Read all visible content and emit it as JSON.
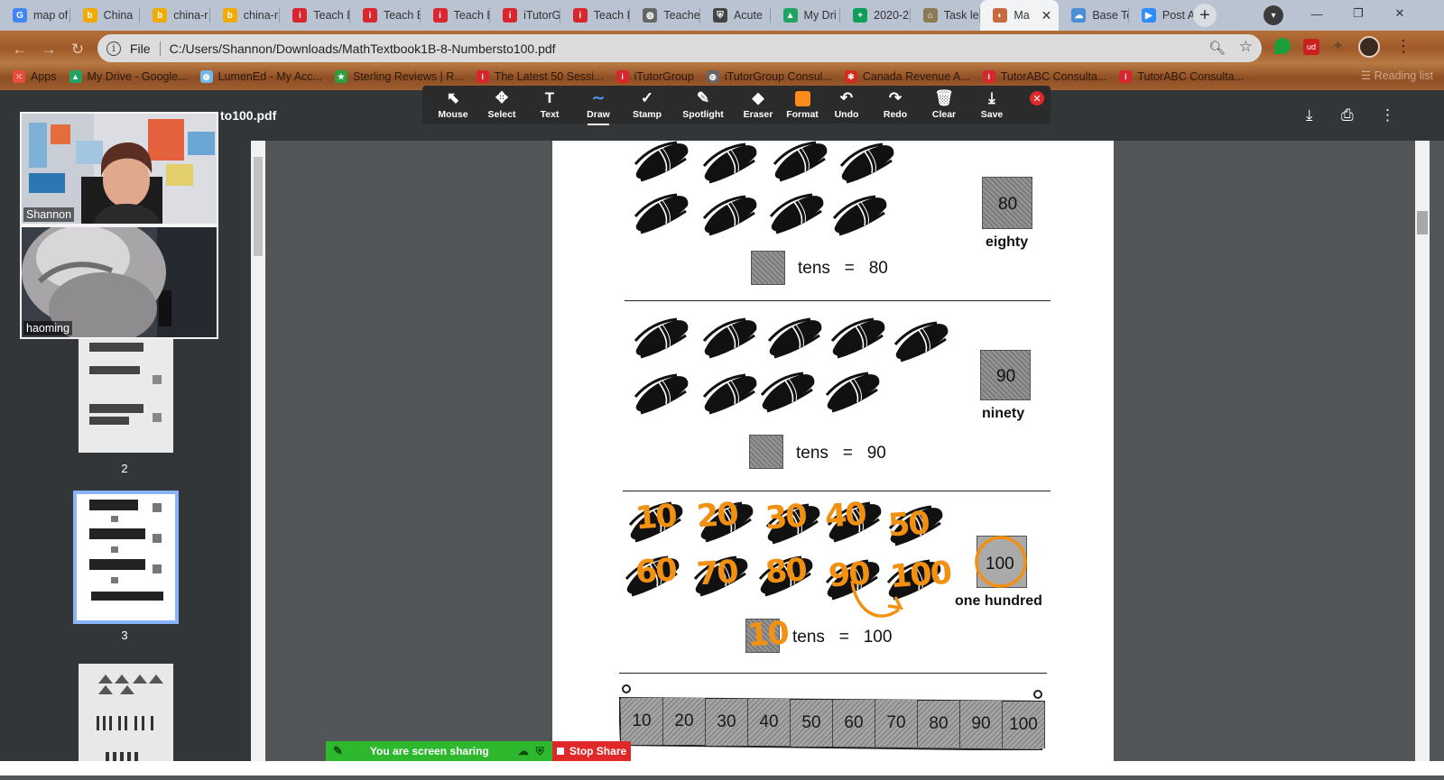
{
  "browser": {
    "tabs": [
      {
        "title": "map of",
        "icon": "google-icon",
        "color": "#4285f4"
      },
      {
        "title": "China",
        "icon": "b-logo-icon",
        "color": "#f2a900"
      },
      {
        "title": "china-r",
        "icon": "b-logo-icon",
        "color": "#f2a900"
      },
      {
        "title": "china-r",
        "icon": "b-logo-icon",
        "color": "#f2a900"
      },
      {
        "title": "Teach E",
        "icon": "i-logo-icon",
        "color": "#d7262e"
      },
      {
        "title": "Teach E",
        "icon": "i-logo-icon",
        "color": "#d7262e"
      },
      {
        "title": "Teach E",
        "icon": "i-logo-icon",
        "color": "#d7262e"
      },
      {
        "title": "iTutorG",
        "icon": "i-logo-icon",
        "color": "#d7262e"
      },
      {
        "title": "Teach E",
        "icon": "i-logo-icon",
        "color": "#d7262e"
      },
      {
        "title": "Teache",
        "icon": "globe-icon",
        "color": "#666666"
      },
      {
        "title": "Acute",
        "icon": "shield-icon",
        "color": "#444444"
      },
      {
        "title": "My Dri",
        "icon": "drive-icon",
        "color": "#1fa463"
      },
      {
        "title": "2020-2",
        "icon": "sheets-icon",
        "color": "#0f9d58"
      },
      {
        "title": "Task le",
        "icon": "doc-icon",
        "color": "#8a7b52"
      },
      {
        "title": "Ma",
        "icon": "pdf-icon",
        "color": "#c66b3d",
        "active": true
      },
      {
        "title": "Base Te",
        "icon": "cloud-icon",
        "color": "#4a90d9"
      },
      {
        "title": "Post At",
        "icon": "zoom-icon",
        "color": "#2d8cff"
      }
    ],
    "address": {
      "scheme": "File",
      "url": "C:/Users/Shannon/Downloads/MathTextbook1B-8-Numbersto100.pdf"
    },
    "bookmarks": [
      {
        "label": "Apps",
        "icon": "apps-icon",
        "color": "#e74c3c"
      },
      {
        "label": "My Drive - Google...",
        "icon": "drive-icon",
        "color": "#1fa463"
      },
      {
        "label": "LumenEd - My Acc...",
        "icon": "lumen-icon",
        "color": "#6fb7e8"
      },
      {
        "label": "Sterling Reviews | R...",
        "icon": "star-icon",
        "color": "#2e9e3d"
      },
      {
        "label": "The Latest 50 Sessi...",
        "icon": "i-logo-icon",
        "color": "#d7262e"
      },
      {
        "label": "iTutorGroup",
        "icon": "i-logo-icon",
        "color": "#d7262e"
      },
      {
        "label": "iTutorGroup Consul...",
        "icon": "globe-icon",
        "color": "#666666"
      },
      {
        "label": "Canada Revenue A...",
        "icon": "maple-icon",
        "color": "#d52b1e"
      },
      {
        "label": "TutorABC Consulta...",
        "icon": "i-logo-icon",
        "color": "#d7262e"
      },
      {
        "label": "TutorABC Consulta...",
        "icon": "i-logo-icon",
        "color": "#d7262e"
      }
    ],
    "reading_list": "Reading list"
  },
  "pdf": {
    "title": "to100.pdf",
    "thumbnails": [
      {
        "page": "2"
      },
      {
        "page": "3",
        "selected": true
      }
    ],
    "sections": [
      {
        "square": "80",
        "word": "eighty",
        "tens_text": "tens",
        "equals": "=",
        "result": "80"
      },
      {
        "square": "90",
        "word": "ninety",
        "tens_text": "tens",
        "equals": "=",
        "result": "90"
      },
      {
        "square": "100",
        "word": "one hundred",
        "tens_text": "tens",
        "equals": "=",
        "result": "100"
      }
    ],
    "ink": {
      "bundle_numbers": [
        "10",
        "20",
        "30",
        "40",
        "50",
        "60",
        "70",
        "80",
        "90",
        "100"
      ],
      "tens_box": "10",
      "color": "#f29111"
    },
    "number_strip": [
      "10",
      "20",
      "30",
      "40",
      "50",
      "60",
      "70",
      "80",
      "90",
      "100"
    ]
  },
  "annotation_toolbar": {
    "tools": [
      {
        "label": "Mouse",
        "icon": "cursor-icon"
      },
      {
        "label": "Select",
        "icon": "move-icon"
      },
      {
        "label": "Text",
        "icon": "text-icon"
      },
      {
        "label": "Draw",
        "icon": "draw-icon",
        "active": true
      },
      {
        "label": "Stamp",
        "icon": "check-icon"
      },
      {
        "label": "Spotlight",
        "icon": "wand-icon"
      },
      {
        "label": "Eraser",
        "icon": "eraser-icon"
      },
      {
        "label": "Format",
        "icon": "format-icon"
      },
      {
        "label": "Undo",
        "icon": "undo-icon"
      },
      {
        "label": "Redo",
        "icon": "redo-icon"
      },
      {
        "label": "Clear",
        "icon": "trash-icon"
      },
      {
        "label": "Save",
        "icon": "save-icon"
      }
    ],
    "format_color": "#ff8c1a"
  },
  "video": {
    "participants": [
      {
        "name": "Shannon"
      },
      {
        "name": "haoming"
      }
    ]
  },
  "share": {
    "status": "You are screen sharing",
    "stop_label": "Stop Share"
  }
}
